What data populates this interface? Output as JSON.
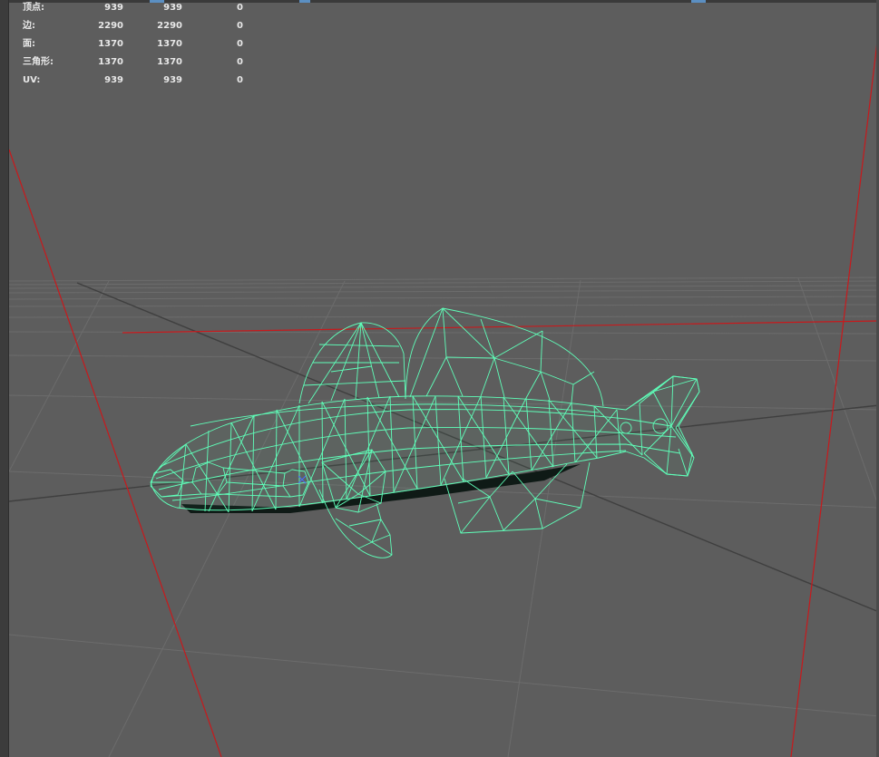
{
  "hud": {
    "rows": [
      {
        "label": "顶点:",
        "v1": "939",
        "v2": "939",
        "v3": "0"
      },
      {
        "label": "边:",
        "v1": "2290",
        "v2": "2290",
        "v3": "0"
      },
      {
        "label": "面:",
        "v1": "1370",
        "v2": "1370",
        "v3": "0"
      },
      {
        "label": "三角形:",
        "v1": "1370",
        "v2": "1370",
        "v3": "0"
      },
      {
        "label": "UV:",
        "v1": "939",
        "v2": "939",
        "v3": "0"
      }
    ]
  },
  "colors": {
    "viewport_bg": "#5d5d5d",
    "grid_line": "#6c6c6c",
    "grid_axis": "#3f3f3f",
    "camera_line": "#c8191c",
    "wireframe": "#5fffb9"
  },
  "icons": {
    "pivot": "pivot-cross-icon"
  }
}
